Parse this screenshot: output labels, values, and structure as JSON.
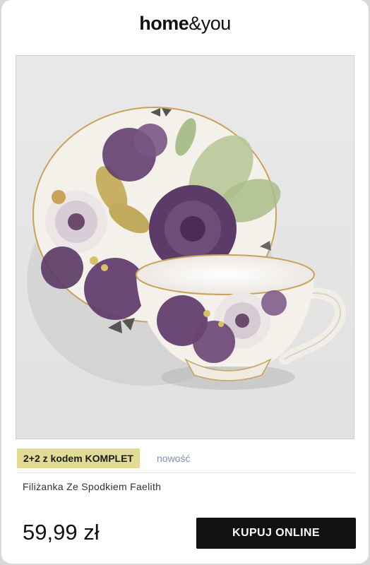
{
  "brand": {
    "name_bold": "home",
    "name_thin": "&you"
  },
  "product": {
    "image_alt": "Filiżanka Ze Spodkiem Faelith",
    "promo_badge": "2+2 z kodem KOMPLET",
    "new_label": "nowość",
    "name": "Filiżanka Ze Spodkiem Faelith",
    "price": "59,99 zł"
  },
  "actions": {
    "buy_label": "KUPUJ ONLINE"
  },
  "colors": {
    "promo_badge_bg": "#e1db95",
    "new_label": "#7d8fbf",
    "button_bg": "#111111",
    "floral_purple": "#5e3a6b"
  }
}
